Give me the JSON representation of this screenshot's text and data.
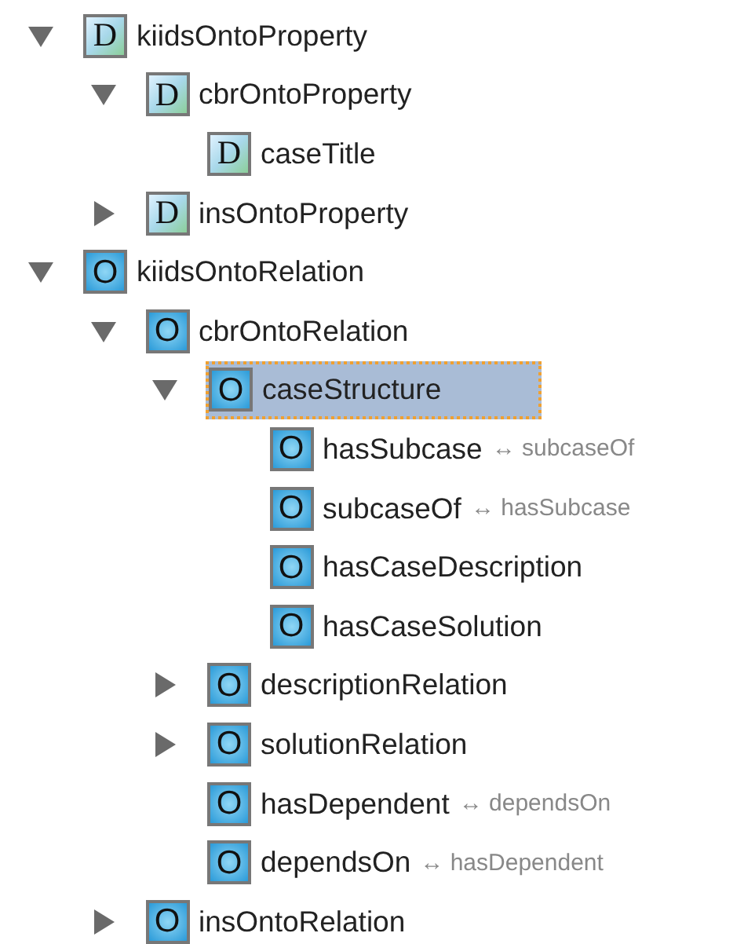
{
  "tree": [
    {
      "label": "kiidsOntoProperty",
      "badge": "D",
      "kind": "property",
      "expanded": true,
      "selected": false,
      "children": [
        {
          "label": "cbrOntoProperty",
          "badge": "D",
          "kind": "property",
          "expanded": true,
          "selected": false,
          "children": [
            {
              "label": "caseTitle",
              "badge": "D",
              "kind": "property",
              "selected": false
            }
          ]
        },
        {
          "label": "insOntoProperty",
          "badge": "D",
          "kind": "property",
          "expanded": false,
          "selected": false
        }
      ]
    },
    {
      "label": "kiidsOntoRelation",
      "badge": "O",
      "kind": "relation",
      "expanded": true,
      "selected": false,
      "children": [
        {
          "label": "cbrOntoRelation",
          "badge": "O",
          "kind": "relation",
          "expanded": true,
          "selected": false,
          "children": [
            {
              "label": "caseStructure",
              "badge": "O",
              "kind": "relation",
              "expanded": true,
              "selected": true,
              "children": [
                {
                  "label": "hasSubcase",
                  "badge": "O",
                  "kind": "relation",
                  "inverse": "↔ subcaseOf",
                  "selected": false
                },
                {
                  "label": "subcaseOf",
                  "badge": "O",
                  "kind": "relation",
                  "inverse": "↔ hasSubcase",
                  "selected": false
                },
                {
                  "label": "hasCaseDescription",
                  "badge": "O",
                  "kind": "relation",
                  "selected": false
                },
                {
                  "label": "hasCaseSolution",
                  "badge": "O",
                  "kind": "relation",
                  "selected": false
                }
              ]
            },
            {
              "label": "descriptionRelation",
              "badge": "O",
              "kind": "relation",
              "expanded": false,
              "selected": false
            },
            {
              "label": "solutionRelation",
              "badge": "O",
              "kind": "relation",
              "expanded": false,
              "selected": false
            },
            {
              "label": "hasDependent",
              "badge": "O",
              "kind": "relation",
              "inverse": "↔ dependsOn",
              "selected": false
            },
            {
              "label": "dependsOn",
              "badge": "O",
              "kind": "relation",
              "inverse": "↔ hasDependent",
              "selected": false
            }
          ]
        },
        {
          "label": "insOntoRelation",
          "badge": "O",
          "kind": "relation",
          "expanded": false,
          "selected": false
        }
      ]
    }
  ]
}
